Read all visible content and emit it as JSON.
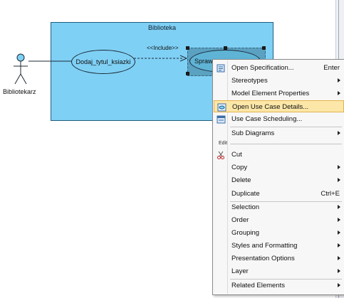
{
  "diagram": {
    "system_name": "Biblioteka",
    "actor_name": "Bibliotekarz",
    "use_case_1": "Dodaj_tytul_ksiazki",
    "use_case_2_partial": "Spraw",
    "include_label": "<<Include>>"
  },
  "context_menu": {
    "items": [
      {
        "label": "Open Specification...",
        "shortcut": "Enter",
        "icon": "specification-icon"
      },
      {
        "label": "Stereotypes",
        "submenu": true
      },
      {
        "label": "Model Element Properties",
        "submenu": true
      },
      {
        "label": "Open Use Case Details...",
        "icon": "use-case-details-icon",
        "highlighted": true
      },
      {
        "label": "Use Case Scheduling...",
        "icon": "scheduling-icon"
      },
      {
        "label": "Sub Diagrams",
        "submenu": true
      },
      {
        "label": "Cut",
        "icon": "scissors-icon"
      },
      {
        "label": "Copy",
        "submenu": true
      },
      {
        "label": "Delete",
        "submenu": true
      },
      {
        "label": "Duplicate",
        "shortcut": "Ctrl+E"
      },
      {
        "label": "Selection",
        "submenu": true
      },
      {
        "label": "Order",
        "submenu": true
      },
      {
        "label": "Grouping",
        "submenu": true
      },
      {
        "label": "Styles and Formatting",
        "submenu": true
      },
      {
        "label": "Presentation Options",
        "submenu": true
      },
      {
        "label": "Layer",
        "submenu": true
      },
      {
        "label": "Related Elements",
        "submenu": true
      }
    ],
    "section_edit": "Edit"
  },
  "colors": {
    "system_fill": "#7fd0f5",
    "highlight": "#fde7a8",
    "menu_bg": "#f7f7f7"
  }
}
